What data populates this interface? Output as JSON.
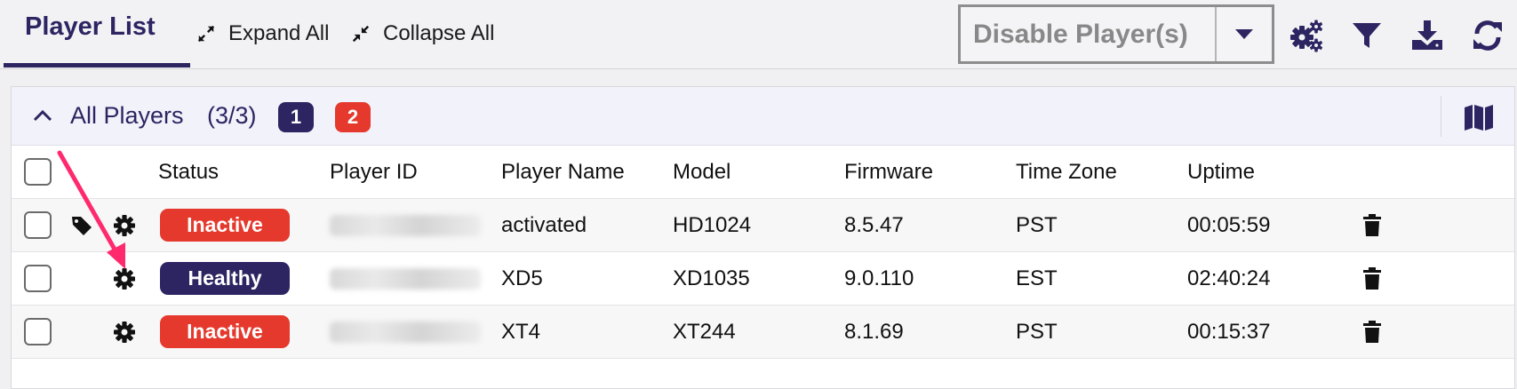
{
  "colors": {
    "brand": "#2d2462",
    "inactive": "#e5392d",
    "healthy": "#2d2462",
    "annotation_arrow": "#ff2a6d"
  },
  "topbar": {
    "tab_label": "Player List",
    "expand_all": "Expand All",
    "collapse_all": "Collapse All",
    "action_select": {
      "value": "Disable Player(s)"
    },
    "icons": [
      "settings-icon",
      "filter-icon",
      "download-icon",
      "refresh-icon"
    ]
  },
  "group": {
    "title": "All Players",
    "count": "(3/3)",
    "badge_blue": "1",
    "badge_red": "2"
  },
  "table": {
    "columns": [
      "Status",
      "Player ID",
      "Player Name",
      "Model",
      "Firmware",
      "Time Zone",
      "Uptime"
    ],
    "rows": [
      {
        "status": "Inactive",
        "status_color": "#e5392d",
        "has_tag": true,
        "player_id": "(blurred)",
        "player_name": "activated",
        "model": "HD1024",
        "firmware": "8.5.47",
        "time_zone": "PST",
        "uptime": "00:05:59"
      },
      {
        "status": "Healthy",
        "status_color": "#2d2462",
        "has_tag": false,
        "player_id": "(blurred)",
        "player_name": "XD5",
        "model": "XD1035",
        "firmware": "9.0.110",
        "time_zone": "EST",
        "uptime": "02:40:24"
      },
      {
        "status": "Inactive",
        "status_color": "#e5392d",
        "has_tag": false,
        "player_id": "(blurred)",
        "player_name": "XT4",
        "model": "XT244",
        "firmware": "8.1.69",
        "time_zone": "PST",
        "uptime": "00:15:37"
      }
    ]
  }
}
